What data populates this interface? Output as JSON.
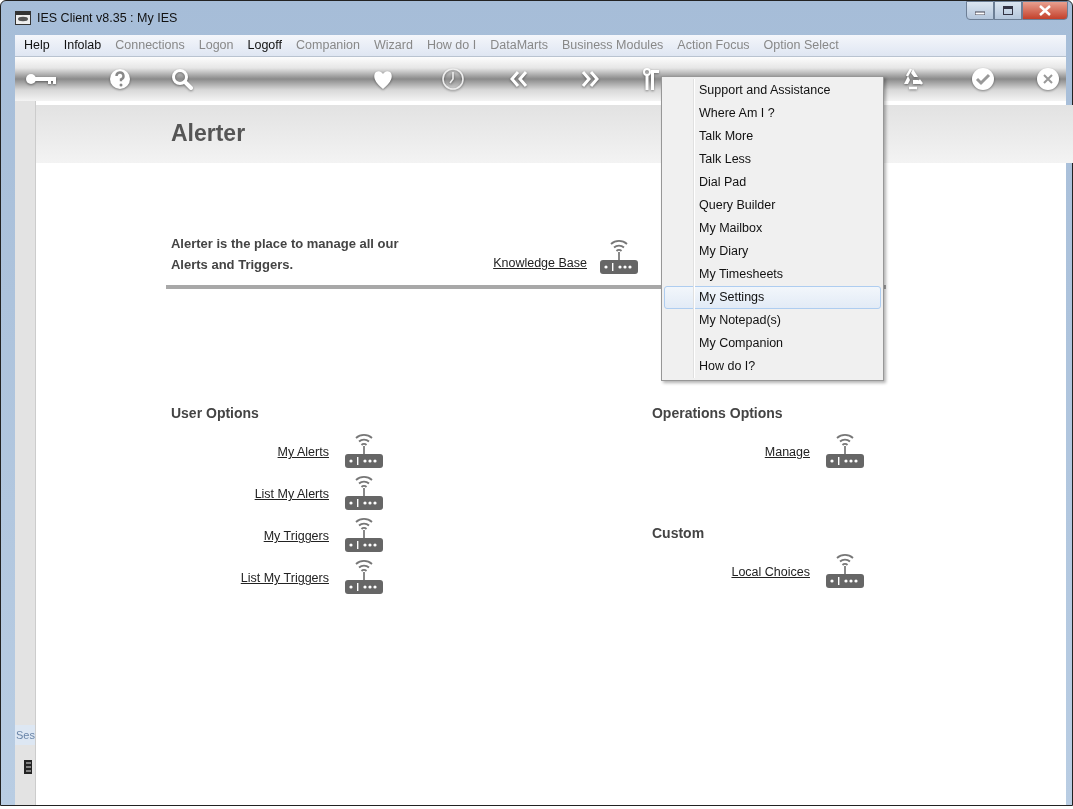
{
  "window": {
    "title": "IES Client v8.35 : My IES"
  },
  "menu_bar": [
    {
      "label": "Help",
      "disabled": false
    },
    {
      "label": "Infolab",
      "disabled": false
    },
    {
      "label": "Connections",
      "disabled": true
    },
    {
      "label": "Logon",
      "disabled": true
    },
    {
      "label": "Logoff",
      "disabled": false
    },
    {
      "label": "Companion",
      "disabled": true
    },
    {
      "label": "Wizard",
      "disabled": true
    },
    {
      "label": "How do I",
      "disabled": true
    },
    {
      "label": "DataMarts",
      "disabled": true
    },
    {
      "label": "Business Modules",
      "disabled": true
    },
    {
      "label": "Action Focus",
      "disabled": true
    },
    {
      "label": "Option Select",
      "disabled": true
    }
  ],
  "popup_menu": {
    "items": [
      {
        "label": "Support and Assistance",
        "selected": false
      },
      {
        "label": "Where Am I ?",
        "selected": false
      },
      {
        "label": "Talk More",
        "selected": false
      },
      {
        "label": "Talk Less",
        "selected": false
      },
      {
        "label": "Dial Pad",
        "selected": false
      },
      {
        "label": "Query Builder",
        "selected": false
      },
      {
        "label": "My Mailbox",
        "selected": false
      },
      {
        "label": "My Diary",
        "selected": false
      },
      {
        "label": "My Timesheets",
        "selected": false
      },
      {
        "label": "My Settings",
        "selected": true
      },
      {
        "label": "My Notepad(s)",
        "selected": false
      },
      {
        "label": "My Companion",
        "selected": false
      },
      {
        "label": "How do I?",
        "selected": false
      }
    ]
  },
  "page": {
    "title": "Alerter",
    "description": "Alerter is the place to manage all our Alerts and Triggers.",
    "knowledge_link": "Knowledge Base"
  },
  "columns": [
    {
      "sections": [
        {
          "title": "User Options",
          "links": [
            "My Alerts",
            "List My Alerts",
            "My Triggers",
            "List My Triggers"
          ]
        }
      ]
    },
    {
      "sections": [
        {
          "title": "Operations Options",
          "links": [
            "Manage"
          ]
        },
        {
          "title": "Custom",
          "links": [
            "Local Choices"
          ]
        }
      ]
    }
  ],
  "side_tab": {
    "label": "Ses"
  }
}
